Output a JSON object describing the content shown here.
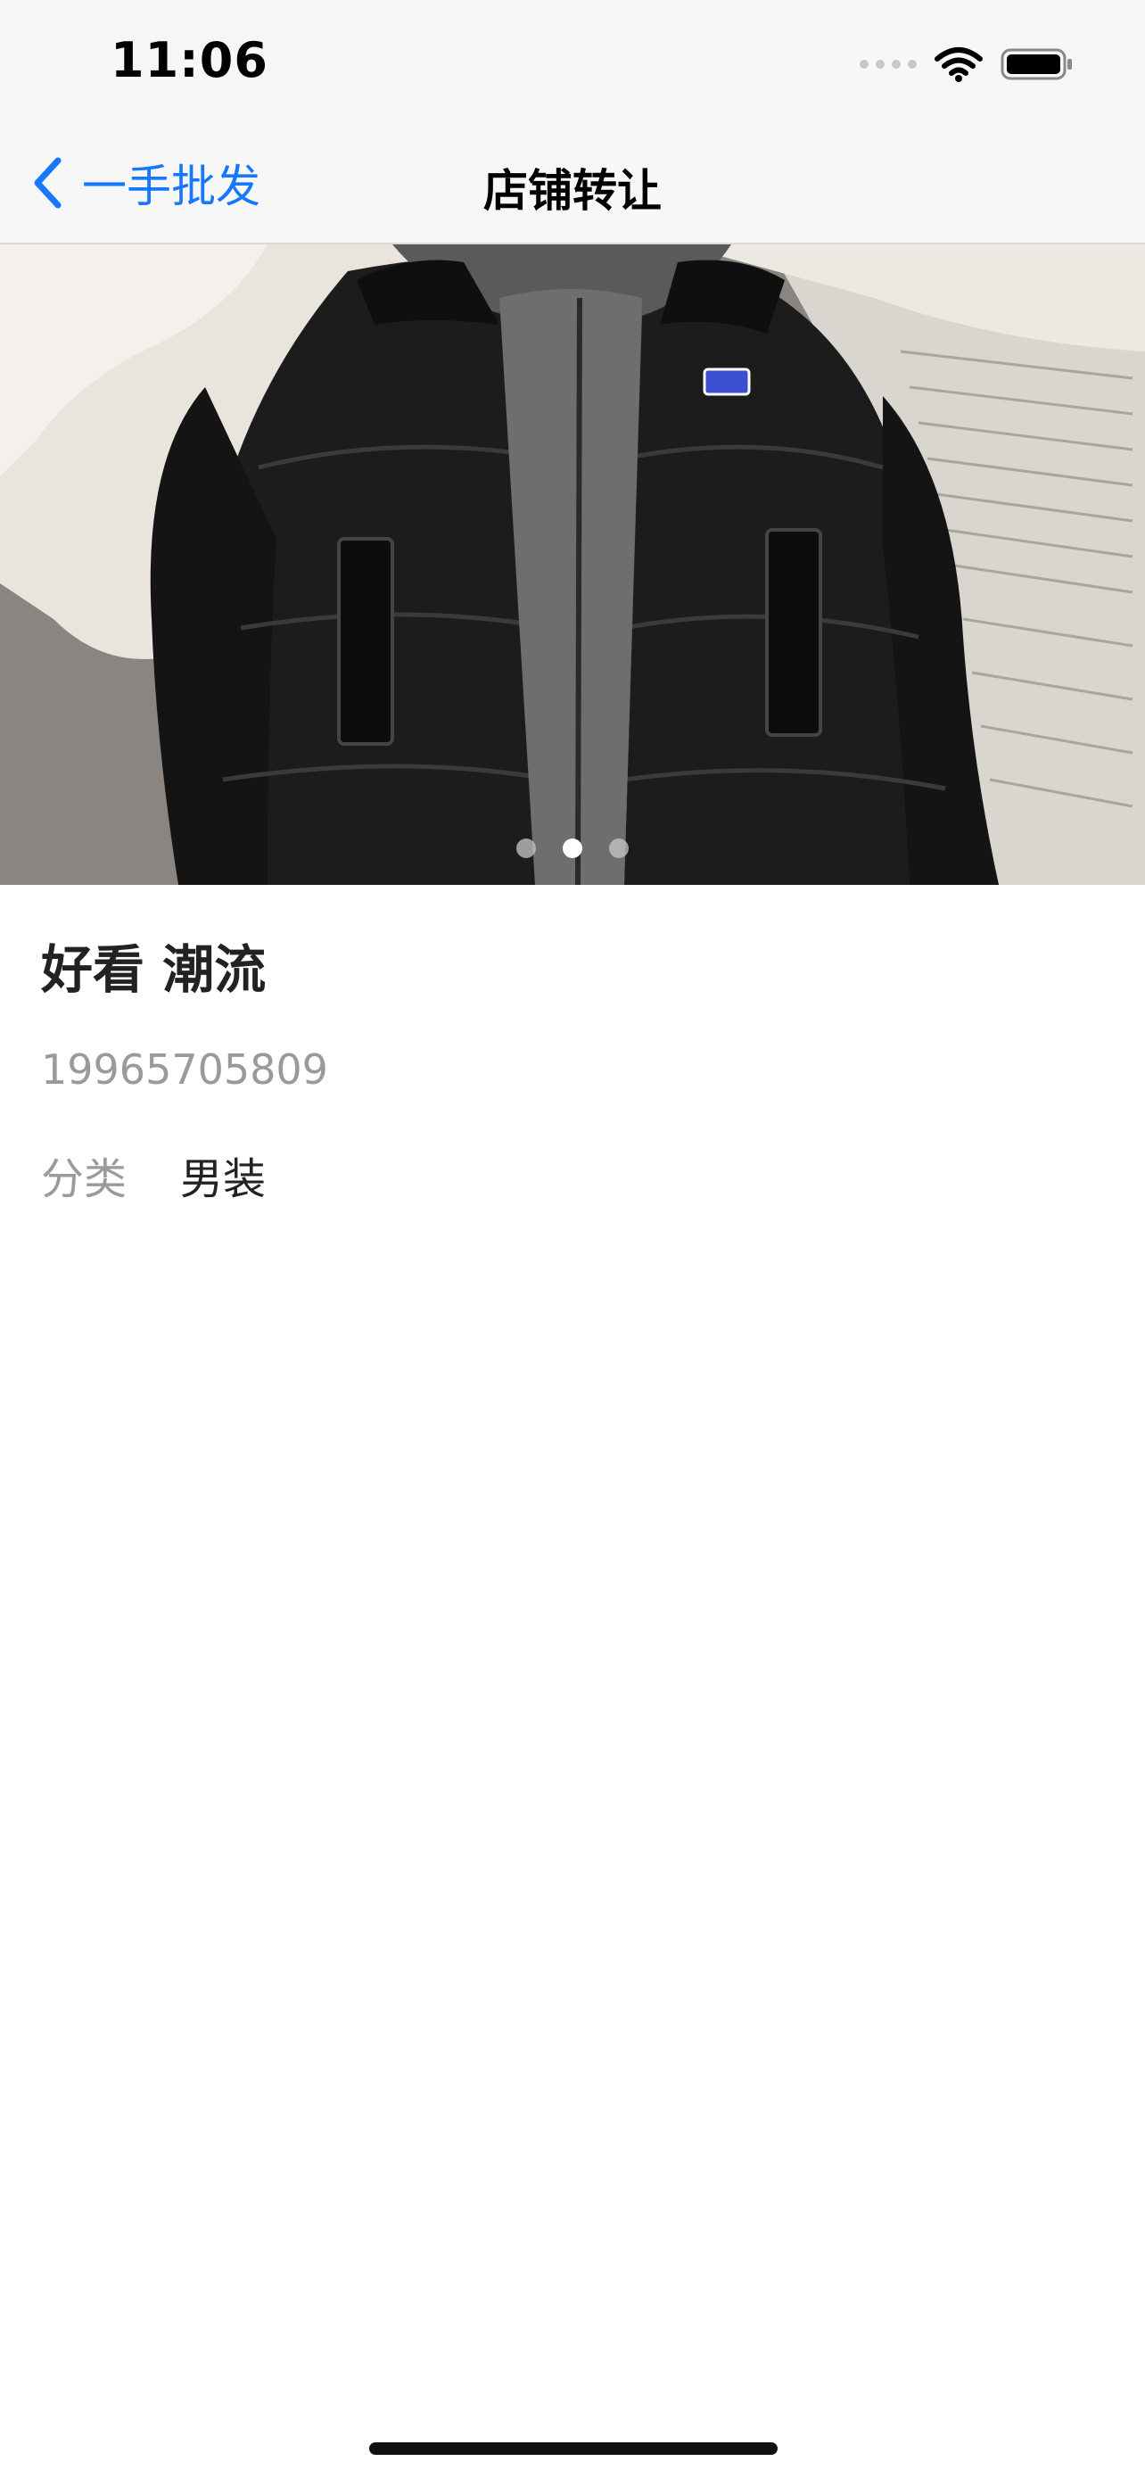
{
  "status_bar": {
    "time": "11:06"
  },
  "nav": {
    "back_label": "一手批发",
    "title": "店铺转让",
    "accent_color": "#1677ff"
  },
  "carousel": {
    "image_subject": "black puffer jacket with grey hood",
    "page_count": 3,
    "active_index": 1
  },
  "listing": {
    "title": "好看 潮流",
    "phone": "19965705809",
    "category_label": "分类",
    "category_value": "男装"
  },
  "icons": [
    "chevron-left-icon",
    "wifi-icon",
    "battery-icon",
    "cellular-signal-icon"
  ]
}
